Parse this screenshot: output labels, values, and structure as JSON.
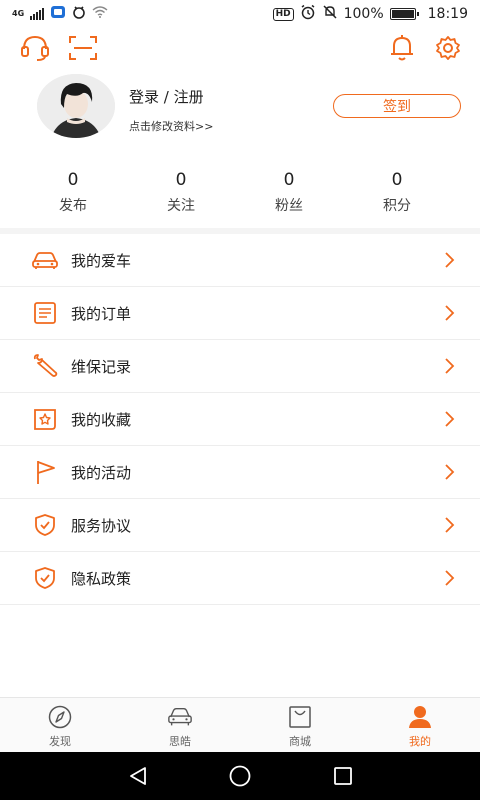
{
  "statusbar": {
    "network_type": "4G",
    "battery_percent": "100%",
    "time": "18:19",
    "hd_label": "HD",
    "icons": [
      "signal-icon",
      "message-notification-icon",
      "bluetooth-icon",
      "wifi-icon",
      "alarm-icon",
      "mute-icon",
      "battery-icon"
    ]
  },
  "header": {
    "icons": [
      "customer-service-headset-icon",
      "scan-icon",
      "notification-bell-icon",
      "settings-gear-icon"
    ]
  },
  "profile": {
    "login_label": "登录 / 注册",
    "edit_label": "点击修改资料>>",
    "checkin_label": "签到"
  },
  "stats": [
    {
      "value": "0",
      "label": "发布"
    },
    {
      "value": "0",
      "label": "关注"
    },
    {
      "value": "0",
      "label": "粉丝"
    },
    {
      "value": "0",
      "label": "积分"
    }
  ],
  "menu": [
    {
      "label": "我的爱车",
      "icon": "car-icon"
    },
    {
      "label": "我的订单",
      "icon": "order-document-icon"
    },
    {
      "label": "维保记录",
      "icon": "wrench-icon"
    },
    {
      "label": "我的收藏",
      "icon": "star-collection-icon"
    },
    {
      "label": "我的活动",
      "icon": "flag-icon"
    },
    {
      "label": "服务协议",
      "icon": "shield-check-icon"
    },
    {
      "label": "隐私政策",
      "icon": "shield-check-icon"
    }
  ],
  "tabbar": [
    {
      "label": "发现",
      "icon": "compass-icon",
      "active": false
    },
    {
      "label": "思皓",
      "icon": "car-front-icon",
      "active": false
    },
    {
      "label": "商城",
      "icon": "shopping-bag-icon",
      "active": false
    },
    {
      "label": "我的",
      "icon": "person-icon",
      "active": true
    }
  ],
  "colors": {
    "accent": "#f06a1e",
    "divider": "#ededed",
    "text": "#222222",
    "navbar": "#000000"
  }
}
